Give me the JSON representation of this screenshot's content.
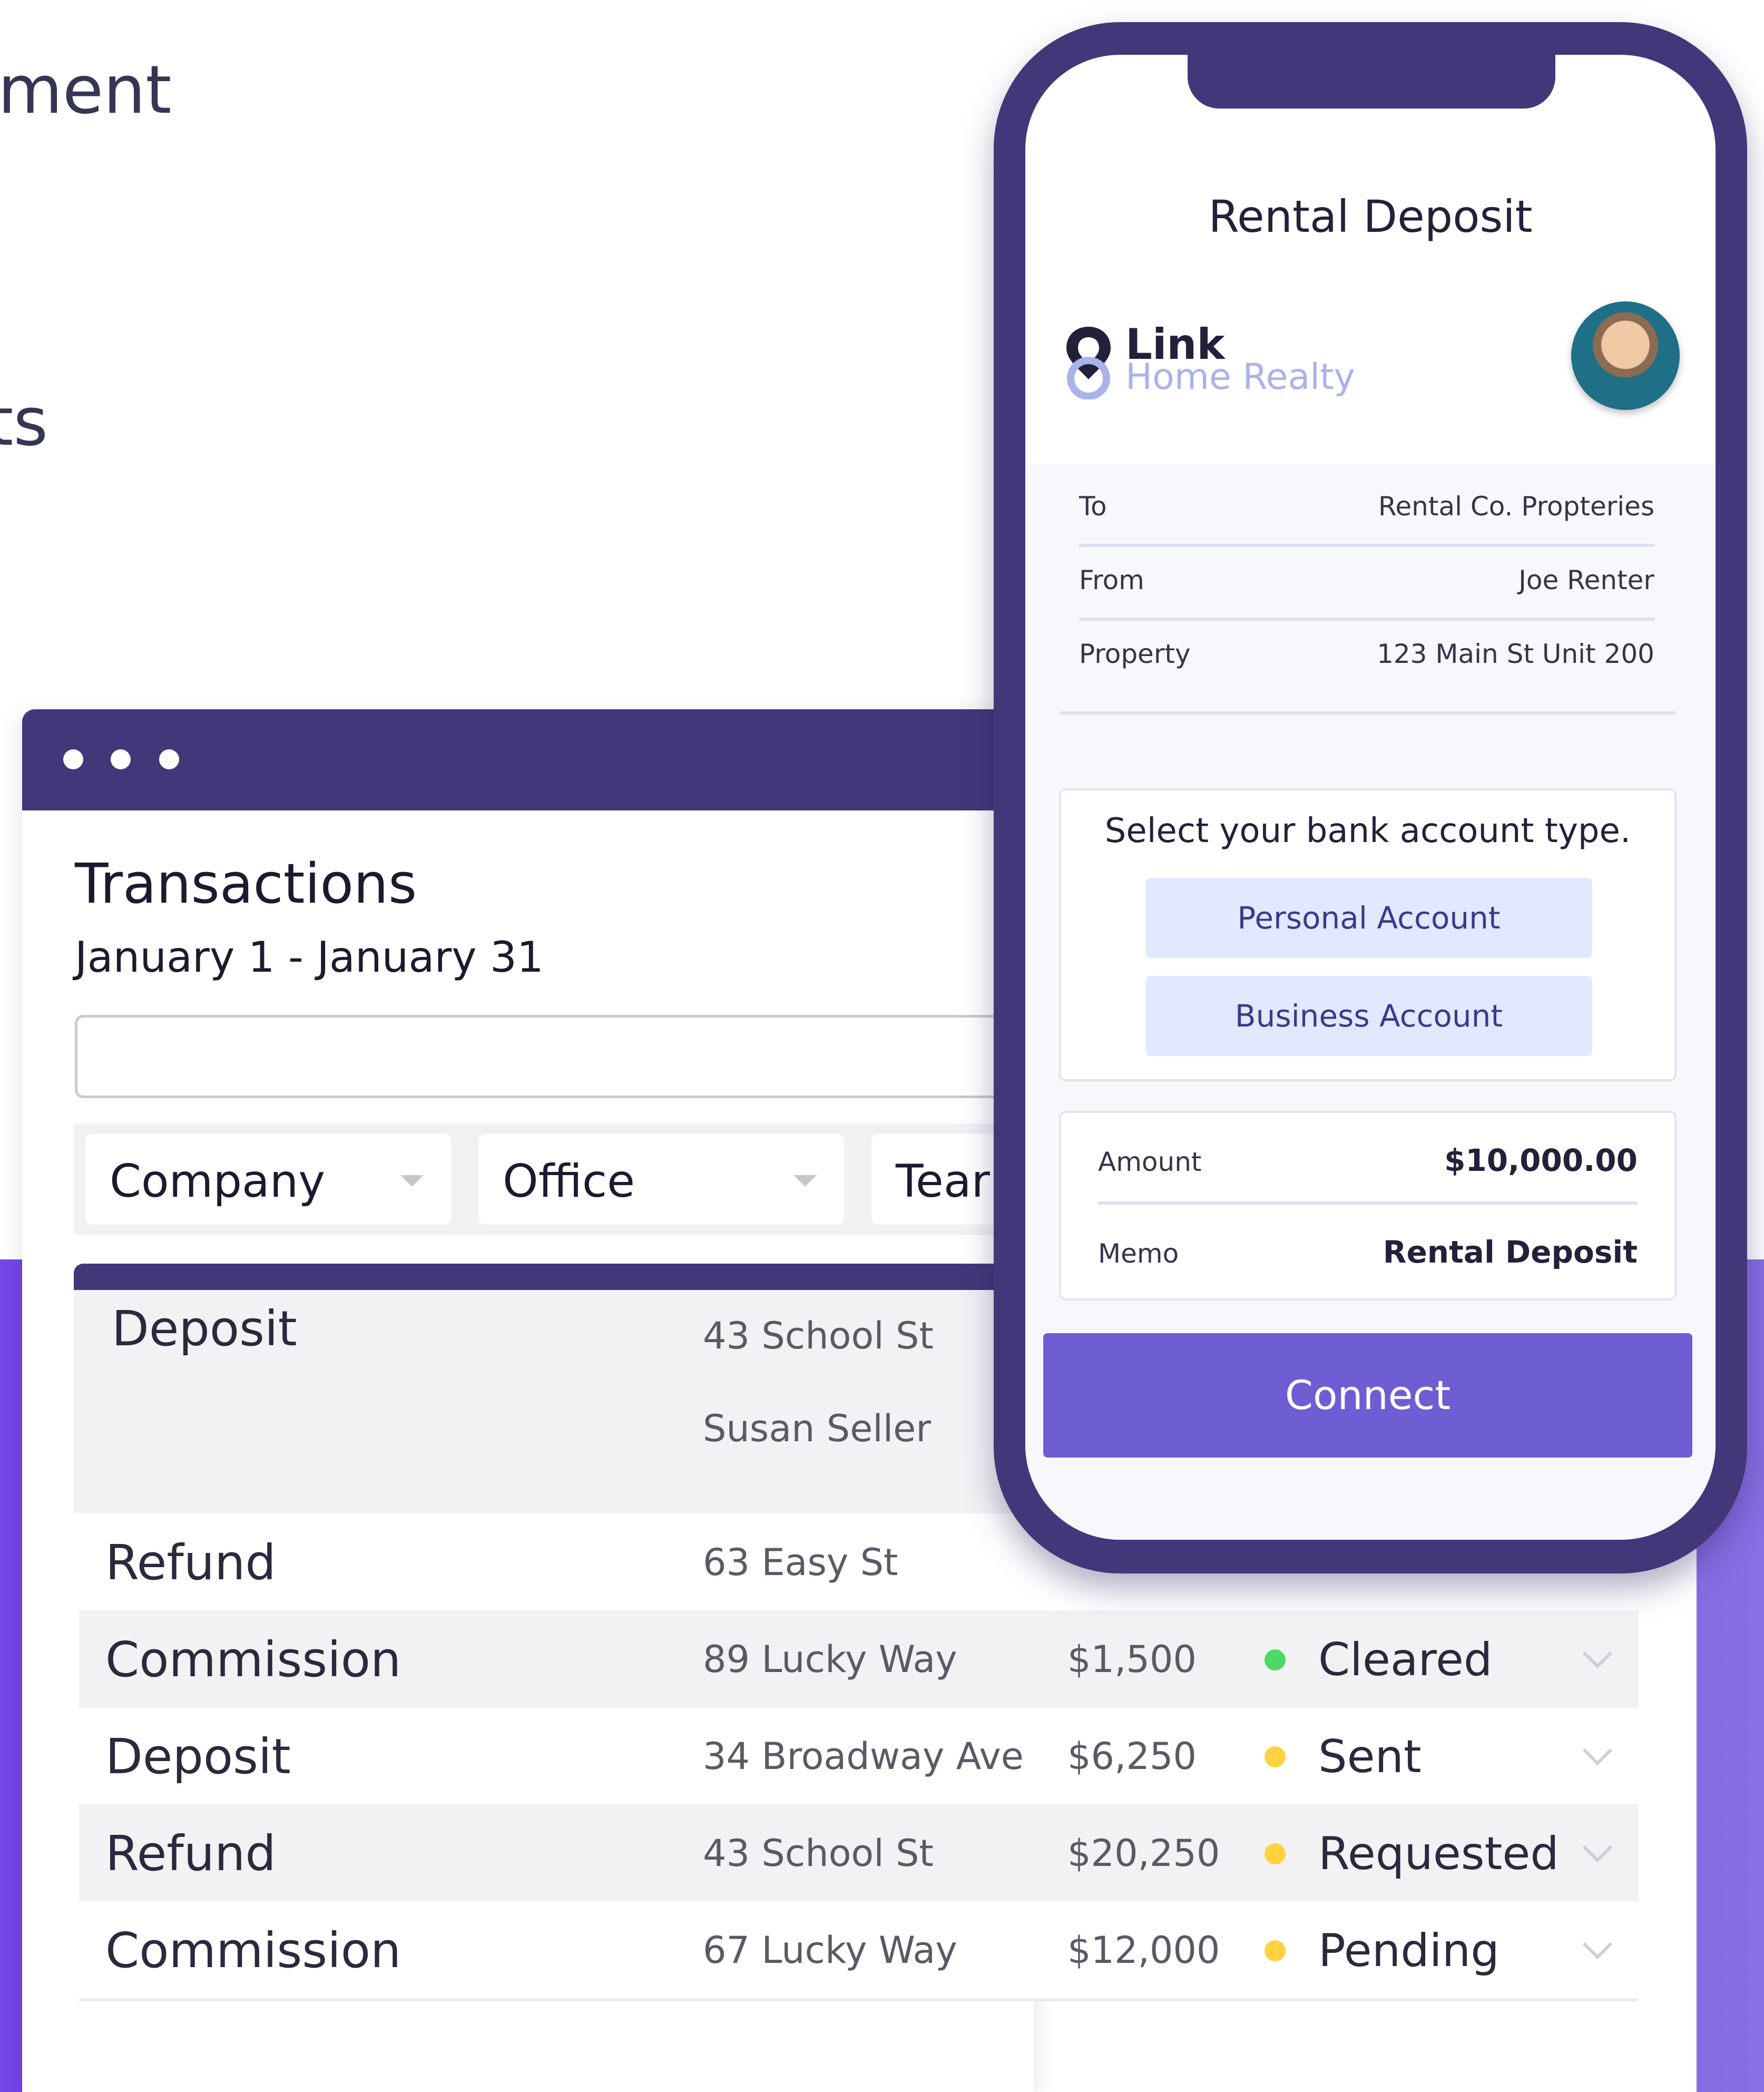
{
  "hero": {
    "line1": "ment",
    "line2": "ts"
  },
  "desktop": {
    "title": "Transactions",
    "date_range": "January 1 - January 31",
    "search": {
      "value": "",
      "placeholder": ""
    },
    "filters": [
      {
        "label": "Company"
      },
      {
        "label": "Office"
      },
      {
        "label": "Tear"
      }
    ],
    "rows": [
      {
        "type": "Deposit",
        "address": "43 School St",
        "party": "Susan Seller"
      },
      {
        "type": "Refund",
        "address": "63 Easy St",
        "amount": "",
        "status": ""
      },
      {
        "type": "Commission",
        "address": "89 Lucky Way",
        "amount": "$1,500",
        "status": "Cleared",
        "status_color": "#4cd964"
      },
      {
        "type": "Deposit",
        "address": "34 Broadway Ave",
        "amount": "$6,250",
        "status": "Sent",
        "status_color": "#ffd23f"
      },
      {
        "type": "Refund",
        "address": "43 School St",
        "amount": "$20,250",
        "status": "Requested",
        "status_color": "#ffd23f"
      },
      {
        "type": "Commission",
        "address": "67 Lucky Way",
        "amount": "$12,000",
        "status": "Pending",
        "status_color": "#ffd23f"
      }
    ]
  },
  "phone": {
    "title": "Rental Deposit",
    "brand": {
      "name": "Link",
      "sub": "Home Realty"
    },
    "details": [
      {
        "key": "To",
        "value": "Rental Co. Propteries"
      },
      {
        "key": "From",
        "value": "Joe Renter"
      },
      {
        "key": "Property",
        "value": "123 Main St Unit 200"
      }
    ],
    "account_prompt": "Select your bank account type.",
    "account_options": [
      "Personal Account",
      "Business Account"
    ],
    "amount": {
      "label": "Amount",
      "value": "$10,000.00"
    },
    "memo": {
      "label": "Memo",
      "value": "Rental Deposit"
    },
    "connect_label": "Connect"
  },
  "colors": {
    "brand_purple": "#433779",
    "accent_button": "#6d5ed3",
    "band_purple": "#7446ea"
  }
}
